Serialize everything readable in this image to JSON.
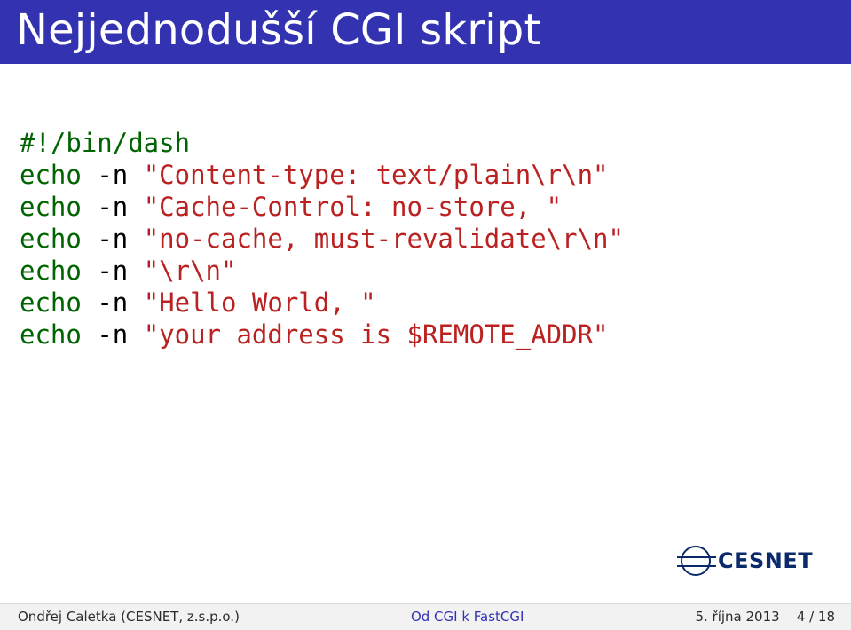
{
  "title": "Nejjednodušší CGI skript",
  "code": {
    "shebang": "#!/bin/dash",
    "lines": [
      {
        "cmd": "echo",
        "flag": "-n",
        "str": "\"Content-type: text/plain\\r\\n\""
      },
      {
        "cmd": "echo",
        "flag": "-n",
        "str": "\"Cache-Control: no-store, \""
      },
      {
        "cmd": "echo",
        "flag": "-n",
        "str": "\"no-cache, must-revalidate\\r\\n\""
      },
      {
        "cmd": "echo",
        "flag": "-n",
        "str": "\"\\r\\n\""
      },
      {
        "cmd": "echo",
        "flag": "-n",
        "str": "\"Hello World, \""
      },
      {
        "cmd": "echo",
        "flag": "-n",
        "str": "\"your address is $REMOTE_ADDR\""
      }
    ]
  },
  "logo_text": "CESNET",
  "footer": {
    "author": "Ondřej Caletka (CESNET, z.s.p.o.)",
    "talk": "Od CGI k FastCGI",
    "date": "5. října 2013",
    "page": "4 / 18"
  }
}
